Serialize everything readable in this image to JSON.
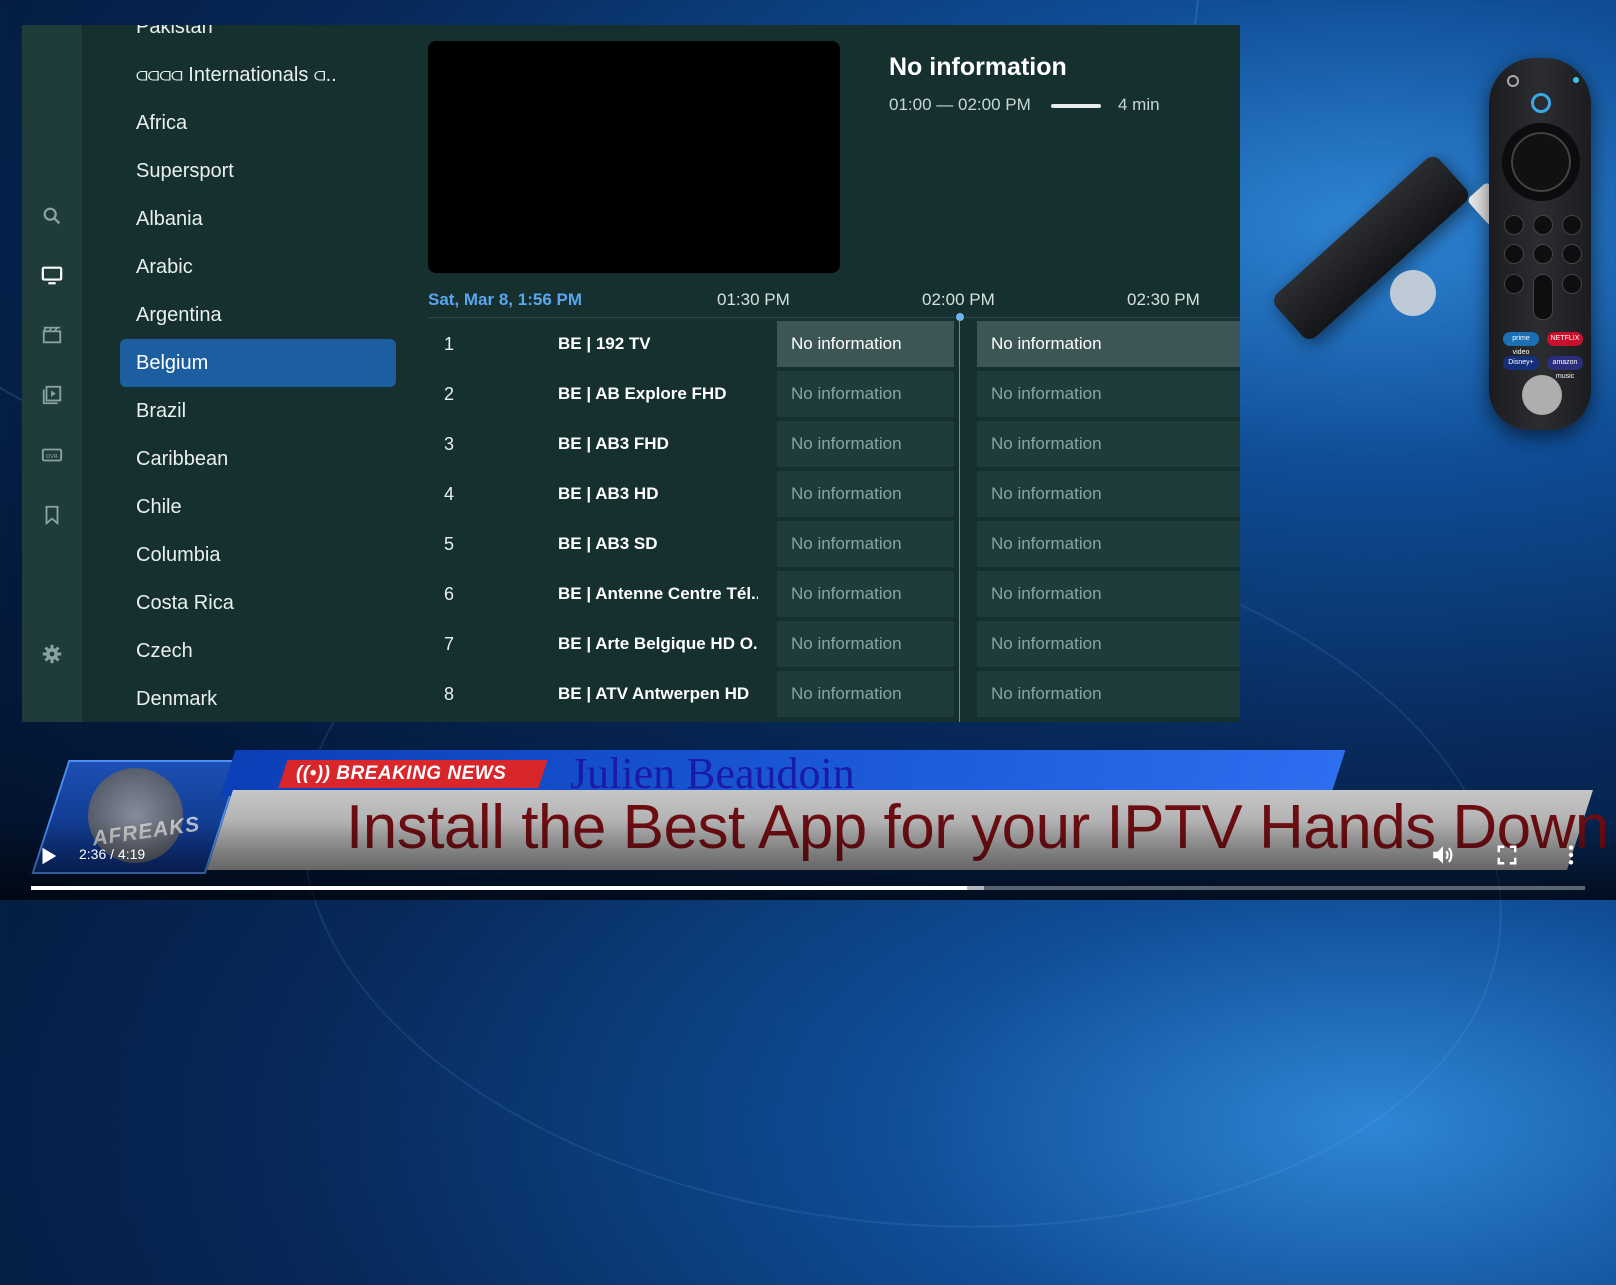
{
  "categories": [
    "Pakistan",
    "⫏⫏⫏⫏ Internationals ⫏..",
    "Africa",
    "Supersport",
    "Albania",
    "Arabic",
    "Argentina",
    "Belgium",
    "Brazil",
    "Caribbean",
    "Chile",
    "Columbia",
    "Costa Rica",
    "Czech",
    "Denmark"
  ],
  "selected_category": "Belgium",
  "program_info": {
    "title": "No information",
    "time_range": "01:00 — 02:00 PM",
    "remaining": "4 min"
  },
  "timeline": {
    "date": "Sat, Mar 8, 1:56 PM",
    "slots": [
      "01:30 PM",
      "02:00 PM",
      "02:30 PM"
    ]
  },
  "channels": [
    {
      "number": "1",
      "name": "BE | 192 TV",
      "prog1": "No information",
      "prog2": "No information"
    },
    {
      "number": "2",
      "name": "BE | AB Explore FHD",
      "prog1": "No information",
      "prog2": "No information"
    },
    {
      "number": "3",
      "name": "BE | AB3 FHD",
      "prog1": "No information",
      "prog2": "No information"
    },
    {
      "number": "4",
      "name": "BE | AB3 HD",
      "prog1": "No information",
      "prog2": "No information"
    },
    {
      "number": "5",
      "name": "BE | AB3 SD",
      "prog1": "No information",
      "prog2": "No information"
    },
    {
      "number": "6",
      "name": "BE | Antenne Centre Tél..",
      "prog1": "No information",
      "prog2": "No information"
    },
    {
      "number": "7",
      "name": "BE | Arte Belgique HD O..",
      "prog1": "No information",
      "prog2": "No information"
    },
    {
      "number": "8",
      "name": "BE | ATV Antwerpen HD",
      "prog1": "No information",
      "prog2": "No information"
    }
  ],
  "remote": {
    "app_buttons": [
      "prime video",
      "NETFLIX",
      "Disney+",
      "amazon music"
    ]
  },
  "banner": {
    "breaking": "((•)) BREAKING NEWS",
    "presenter": "Julien Beaudoin",
    "headline": "Install the Best App for your IPTV Hands Down",
    "logo_text": "AFREAKS"
  },
  "player": {
    "current_time": "2:36",
    "duration": "4:19",
    "time_display": "2:36 / 4:19",
    "progress": 0.6023
  },
  "colors": {
    "selected_category": "#1d5ea0",
    "timeline_date": "#5aa6ec",
    "breaking_red": "#d8262b",
    "headline": "#6c0d12"
  }
}
